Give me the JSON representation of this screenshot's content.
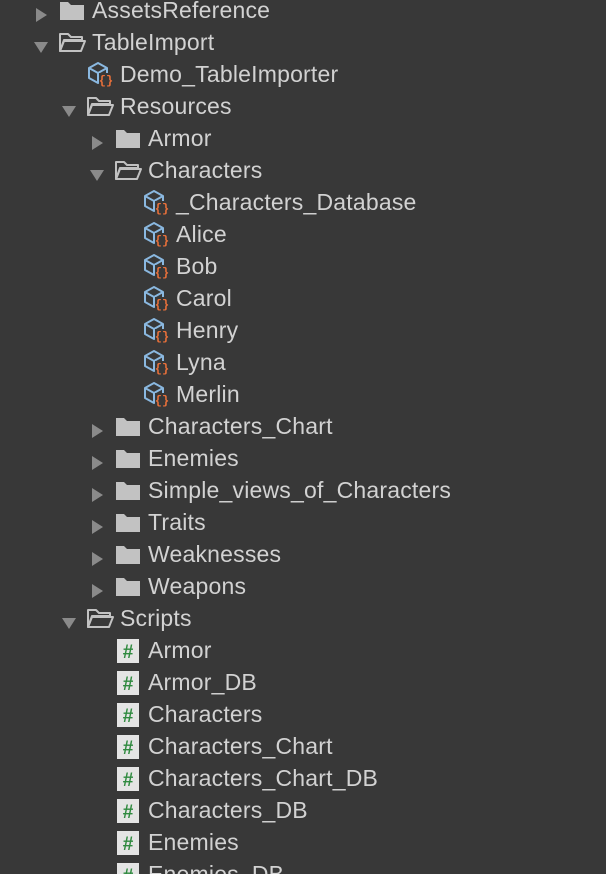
{
  "colors": {
    "background": "#383838",
    "text": "#d2d2d2",
    "arrow": "#8a8a8a",
    "folder": "#c2c2c2",
    "prefab": "#8ab8e0",
    "brace": "#e8703a",
    "script_bg": "#e4e4e4",
    "script_hash": "#2f8a3f"
  },
  "tree": [
    {
      "label": "AssetsReference",
      "depth": 1,
      "icon": "folder-closed",
      "arrow": "collapsed",
      "partial": true
    },
    {
      "label": "TableImport",
      "depth": 1,
      "icon": "folder-open",
      "arrow": "expanded"
    },
    {
      "label": "Demo_TableImporter",
      "depth": 2,
      "icon": "prefab-data",
      "arrow": "none"
    },
    {
      "label": "Resources",
      "depth": 2,
      "icon": "folder-open",
      "arrow": "expanded"
    },
    {
      "label": "Armor",
      "depth": 3,
      "icon": "folder-closed",
      "arrow": "collapsed"
    },
    {
      "label": "Characters",
      "depth": 3,
      "icon": "folder-open",
      "arrow": "expanded"
    },
    {
      "label": "_Characters_Database",
      "depth": 4,
      "icon": "prefab-data",
      "arrow": "none"
    },
    {
      "label": "Alice",
      "depth": 4,
      "icon": "prefab-data",
      "arrow": "none"
    },
    {
      "label": "Bob",
      "depth": 4,
      "icon": "prefab-data",
      "arrow": "none"
    },
    {
      "label": "Carol",
      "depth": 4,
      "icon": "prefab-data",
      "arrow": "none"
    },
    {
      "label": "Henry",
      "depth": 4,
      "icon": "prefab-data",
      "arrow": "none"
    },
    {
      "label": "Lyna",
      "depth": 4,
      "icon": "prefab-data",
      "arrow": "none"
    },
    {
      "label": "Merlin",
      "depth": 4,
      "icon": "prefab-data",
      "arrow": "none"
    },
    {
      "label": "Characters_Chart",
      "depth": 3,
      "icon": "folder-closed",
      "arrow": "collapsed"
    },
    {
      "label": "Enemies",
      "depth": 3,
      "icon": "folder-closed",
      "arrow": "collapsed"
    },
    {
      "label": "Simple_views_of_Characters",
      "depth": 3,
      "icon": "folder-closed",
      "arrow": "collapsed"
    },
    {
      "label": "Traits",
      "depth": 3,
      "icon": "folder-closed",
      "arrow": "collapsed"
    },
    {
      "label": "Weaknesses",
      "depth": 3,
      "icon": "folder-closed",
      "arrow": "collapsed"
    },
    {
      "label": "Weapons",
      "depth": 3,
      "icon": "folder-closed",
      "arrow": "collapsed"
    },
    {
      "label": "Scripts",
      "depth": 2,
      "icon": "folder-open",
      "arrow": "expanded"
    },
    {
      "label": "Armor",
      "depth": 3,
      "icon": "cs-script",
      "arrow": "none"
    },
    {
      "label": "Armor_DB",
      "depth": 3,
      "icon": "cs-script",
      "arrow": "none"
    },
    {
      "label": "Characters",
      "depth": 3,
      "icon": "cs-script",
      "arrow": "none"
    },
    {
      "label": "Characters_Chart",
      "depth": 3,
      "icon": "cs-script",
      "arrow": "none"
    },
    {
      "label": "Characters_Chart_DB",
      "depth": 3,
      "icon": "cs-script",
      "arrow": "none"
    },
    {
      "label": "Characters_DB",
      "depth": 3,
      "icon": "cs-script",
      "arrow": "none"
    },
    {
      "label": "Enemies",
      "depth": 3,
      "icon": "cs-script",
      "arrow": "none"
    },
    {
      "label": "Enemies_DB",
      "depth": 3,
      "icon": "cs-script",
      "arrow": "none"
    }
  ]
}
